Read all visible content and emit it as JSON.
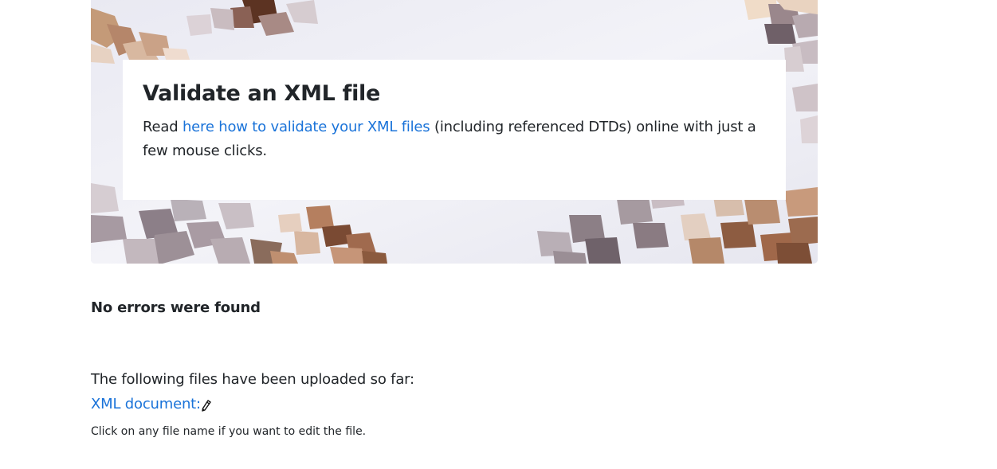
{
  "hero": {
    "title": "Validate an XML file",
    "intro_before": "Read ",
    "intro_link": "here how to validate your XML files",
    "intro_after": " (including referenced DTDs) online with just a few mouse clicks."
  },
  "result": {
    "message": "No errors were found"
  },
  "uploads": {
    "heading": "The following files have been uploaded so far:",
    "files": [
      {
        "label": "XML document:",
        "icon": "pencil-icon"
      }
    ],
    "hint": "Click on any file name if you want to edit the file."
  },
  "colors": {
    "link": "#1a73d9",
    "text": "#212529",
    "hero_background": "#eeeef5"
  }
}
